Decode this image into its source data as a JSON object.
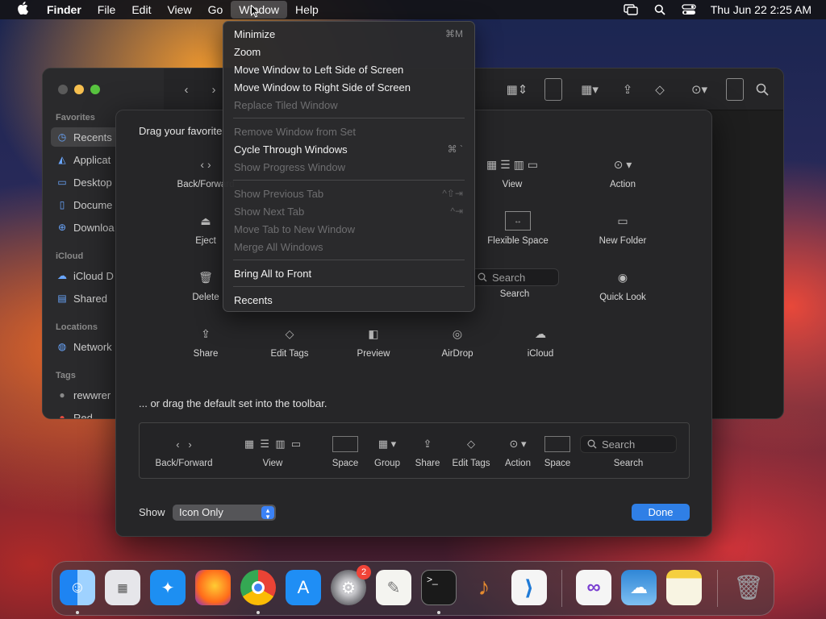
{
  "menubar": {
    "apple_icon": "apple-icon",
    "app_name": "Finder",
    "menus": [
      "File",
      "Edit",
      "View",
      "Go",
      "Window",
      "Help"
    ],
    "active_menu": "Window",
    "status_icons": [
      "screen-mirroring-icon",
      "search-icon",
      "control-center-icon"
    ],
    "clock": "Thu Jun 22  2:25 AM"
  },
  "finder_sidebar": {
    "sections": {
      "favorites": "Favorites",
      "icloud": "iCloud",
      "locations": "Locations",
      "tags": "Tags"
    },
    "items": [
      {
        "label": "Recents",
        "icon": "clock-icon"
      },
      {
        "label": "Applicat",
        "icon": "applications-icon"
      },
      {
        "label": "Desktop",
        "icon": "desktop-icon"
      },
      {
        "label": "Docume",
        "icon": "document-icon"
      },
      {
        "label": "Downloa",
        "icon": "download-icon"
      },
      {
        "label": "iCloud D",
        "icon": "cloud-icon"
      },
      {
        "label": "Shared",
        "icon": "shared-folder-icon"
      },
      {
        "label": "Network",
        "icon": "network-icon"
      },
      {
        "label": "rewwrer",
        "icon": "tag-dot-icon"
      },
      {
        "label": "Red",
        "icon": "tag-dot-icon"
      }
    ]
  },
  "sheet": {
    "heading": "Drag your favorite",
    "palette": [
      {
        "label": "Back/Forward",
        "glyph": "‹  ›"
      },
      {
        "label": "View",
        "glyph": "▦ ☰ ▥ ▭"
      },
      {
        "label": "Action",
        "glyph": "⊙ ▾"
      },
      {
        "label": "Eject",
        "glyph": "⏏"
      },
      {
        "label": "Flexible Space",
        "glyph": "↔"
      },
      {
        "label": "New Folder",
        "glyph": "▭"
      },
      {
        "label": "Delete",
        "glyph": "🗑"
      },
      {
        "label": "Search",
        "glyph": "Search"
      },
      {
        "label": "Quick Look",
        "glyph": "◉"
      },
      {
        "label": "Share",
        "glyph": "⇪"
      },
      {
        "label": "Edit Tags",
        "glyph": "◇"
      },
      {
        "label": "Preview",
        "glyph": "◧"
      },
      {
        "label": "AirDrop",
        "glyph": "◎"
      },
      {
        "label": "iCloud",
        "glyph": "☁"
      }
    ],
    "default_label": "... or drag the default set into the toolbar.",
    "default_set": [
      {
        "label": "Back/Forward"
      },
      {
        "label": "View"
      },
      {
        "label": "Space"
      },
      {
        "label": "Group"
      },
      {
        "label": "Share"
      },
      {
        "label": "Edit Tags"
      },
      {
        "label": "Action"
      },
      {
        "label": "Space"
      },
      {
        "label": "Search"
      }
    ],
    "search_placeholder": "Search",
    "show_label": "Show",
    "show_value": "Icon Only",
    "done_label": "Done"
  },
  "window_menu": {
    "items": [
      {
        "label": "Minimize",
        "shortcut": "⌘M",
        "enabled": true
      },
      {
        "label": "Zoom",
        "shortcut": "",
        "enabled": true
      },
      {
        "label": "Move Window to Left Side of Screen",
        "shortcut": "",
        "enabled": true
      },
      {
        "label": "Move Window to Right Side of Screen",
        "shortcut": "",
        "enabled": true
      },
      {
        "label": "Replace Tiled Window",
        "shortcut": "",
        "enabled": false
      },
      {
        "separator": true
      },
      {
        "label": "Remove Window from Set",
        "shortcut": "",
        "enabled": false
      },
      {
        "label": "Cycle Through Windows",
        "shortcut": "⌘ `",
        "enabled": true
      },
      {
        "label": "Show Progress Window",
        "shortcut": "",
        "enabled": false
      },
      {
        "separator": true
      },
      {
        "label": "Show Previous Tab",
        "shortcut": "^⇧⇥",
        "enabled": false
      },
      {
        "label": "Show Next Tab",
        "shortcut": "^⇥",
        "enabled": false
      },
      {
        "label": "Move Tab to New Window",
        "shortcut": "",
        "enabled": false
      },
      {
        "label": "Merge All Windows",
        "shortcut": "",
        "enabled": false
      },
      {
        "separator": true
      },
      {
        "label": "Bring All to Front",
        "shortcut": "",
        "enabled": true
      },
      {
        "separator": true
      },
      {
        "label": "Recents",
        "shortcut": "",
        "enabled": true
      }
    ]
  },
  "dock": {
    "apps": [
      {
        "name": "finder-icon",
        "color": "#2f8cf0",
        "running": true
      },
      {
        "name": "launchpad-icon",
        "color": "#e6e6ea",
        "running": false
      },
      {
        "name": "safari-icon",
        "color": "#1d8ff2",
        "running": false
      },
      {
        "name": "firefox-icon",
        "color": "#ff7a1a",
        "running": false
      },
      {
        "name": "chrome-icon",
        "color": "#f3f3f3",
        "running": true
      },
      {
        "name": "app-store-icon",
        "color": "#1f8ef5",
        "running": false
      },
      {
        "name": "system-settings-icon",
        "color": "#8e8e93",
        "running": false,
        "badge": "2"
      },
      {
        "name": "textedit-icon",
        "color": "#f4f4f0",
        "running": false
      },
      {
        "name": "terminal-icon",
        "color": "#1a1a1a",
        "running": true
      },
      {
        "name": "garageband-icon",
        "color": "#e58a2f",
        "running": false
      },
      {
        "name": "vscode-icon",
        "color": "#f5f5f5",
        "running": false
      },
      {
        "name": "visual-studio-icon",
        "color": "#f5f5f5",
        "running": false
      },
      {
        "name": "weather-icon",
        "color": "#2f86d6",
        "running": false
      },
      {
        "name": "notes-icon",
        "color": "#f8f4e2",
        "running": false
      },
      {
        "name": "trash-icon",
        "color": "#6d6d72",
        "running": false
      }
    ]
  }
}
